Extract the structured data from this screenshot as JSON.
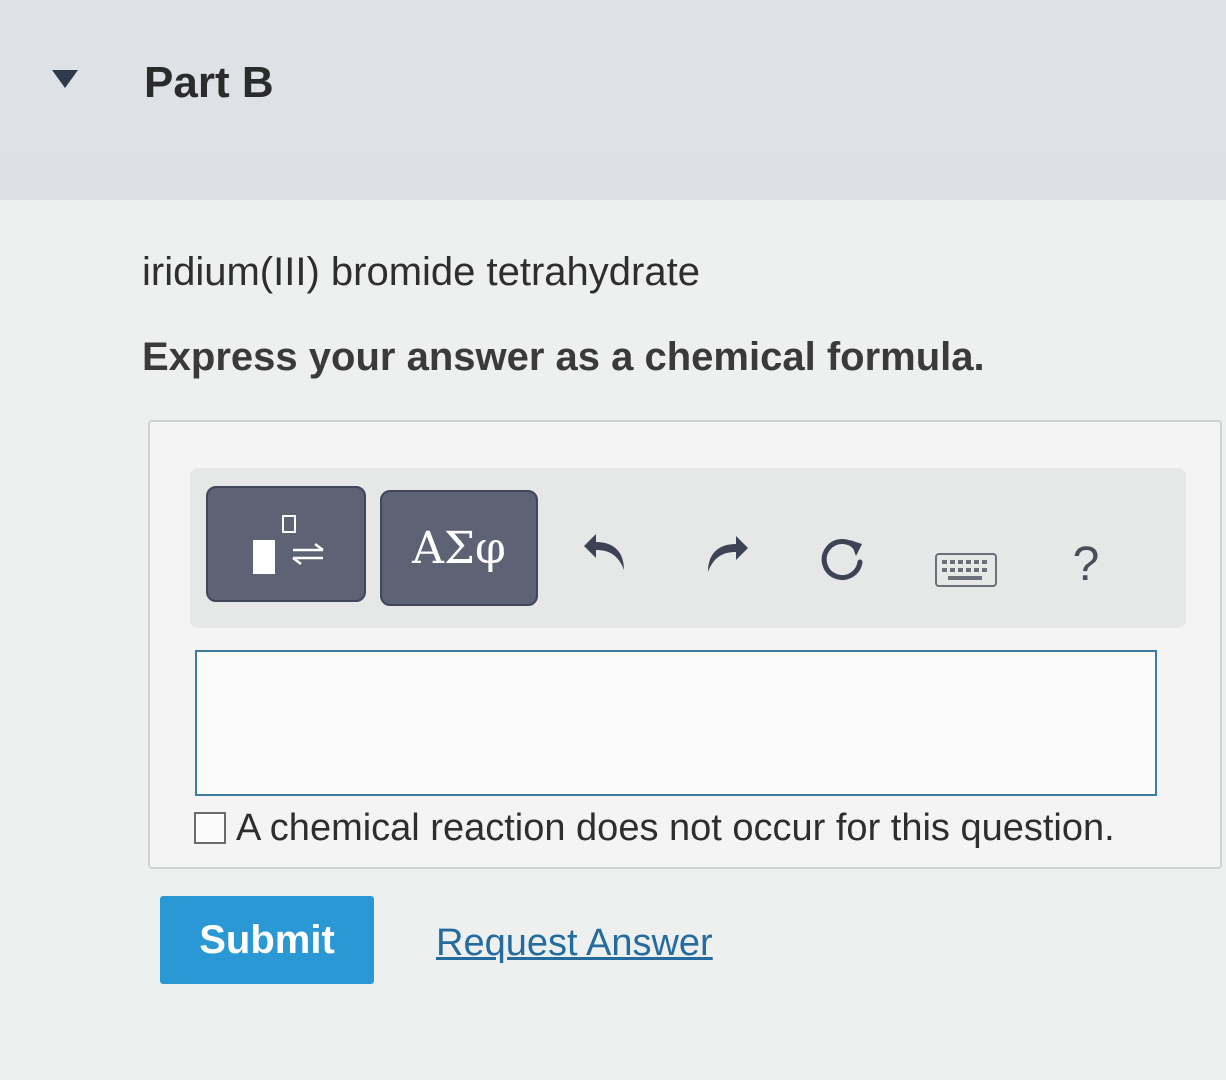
{
  "part": {
    "title": "Part B",
    "collapse_icon": "triangle-down-icon"
  },
  "question": {
    "text": "iridium(III) bromide tetrahydrate",
    "instruction": "Express your answer as a chemical formula."
  },
  "toolbar": {
    "templates_icon": "template-superscript-equilibrium-icon",
    "symbols_label": "ΑΣφ",
    "undo_icon": "undo-icon",
    "redo_icon": "redo-icon",
    "reset_icon": "reset-icon",
    "keyboard_icon": "keyboard-icon",
    "help_label": "?"
  },
  "answer": {
    "value": "",
    "no_reaction_label": "A chemical reaction does not occur for this question.",
    "no_reaction_checked": false
  },
  "actions": {
    "submit_label": "Submit",
    "request_answer_label": "Request Answer"
  },
  "colors": {
    "submit": "#2b98d6",
    "toolbar_button": "#5d6275",
    "link": "#246b9e",
    "input_border": "#3d7ca0"
  }
}
